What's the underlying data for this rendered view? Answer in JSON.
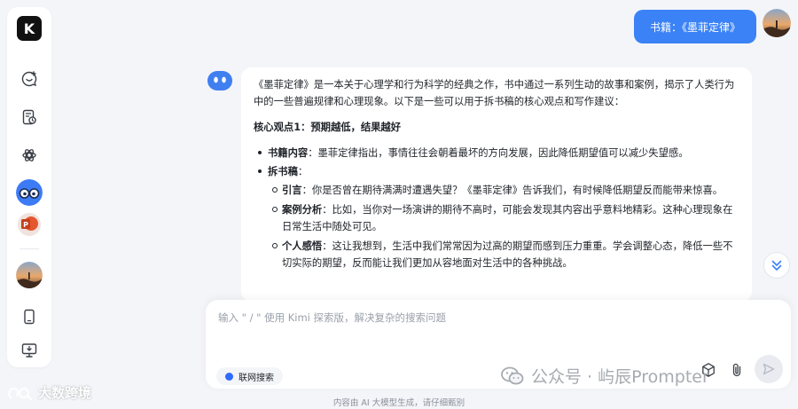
{
  "sidebar": {
    "logo_label": "K",
    "items": [
      {
        "name": "new-chat",
        "icon": "new-chat-icon"
      },
      {
        "name": "history",
        "icon": "history-icon"
      },
      {
        "name": "kimi-plus",
        "icon": "apps-icon"
      },
      {
        "name": "agent-glasses",
        "icon": "glasses-avatar"
      },
      {
        "name": "ppt-agent",
        "icon": "ppt-icon"
      },
      {
        "name": "user-profile",
        "icon": "avatar"
      },
      {
        "name": "mobile-app",
        "icon": "phone-icon"
      },
      {
        "name": "desktop-app",
        "icon": "desktop-icon"
      }
    ]
  },
  "chat": {
    "user_message": "书籍：《墨菲定律》",
    "answer": {
      "intro": "《墨菲定律》是一本关于心理学和行为科学的经典之作，书中通过一系列生动的故事和案例，揭示了人类行为中的一些普遍规律和心理现象。以下是一些可以用于拆书稿的核心观点和写作建议：",
      "heading": "核心观点1：预期越低，结果越好",
      "book_content_label": "书籍内容",
      "book_content_text": "：墨菲定律指出，事情往往会朝着最坏的方向发展，因此降低期望值可以减少失望感。",
      "breakdown_label": "拆书稿",
      "breakdown_colon": "：",
      "sub_items": [
        {
          "label": "引言",
          "text": "：你是否曾在期待满满时遭遇失望？《墨菲定律》告诉我们，有时候降低期望反而能带来惊喜。"
        },
        {
          "label": "案例分析",
          "text": "：比如，当你对一场演讲的期待不高时，可能会发现其内容出乎意料地精彩。这种心理现象在日常生活中随处可见。"
        },
        {
          "label": "个人感悟",
          "text": "：这让我想到，生活中我们常常因为过高的期望而感到压力重重。学会调整心态，降低一些不切实际的期望，反而能让我们更加从容地面对生活中的各种挑战。"
        }
      ]
    }
  },
  "input": {
    "placeholder": "输入 \" / \" 使用 Kimi 探索版，解决复杂的搜索问题",
    "web_search_label": "联网搜索"
  },
  "footer_note": "内容由 AI 大模型生成，请仔细甄别",
  "watermarks": {
    "left": "大数跨境",
    "right": "公众号 · 屿辰Prompter"
  },
  "colors": {
    "accent": "#3b82f6",
    "background": "#f4f5f9",
    "web_search_dot": "#2f6bff"
  }
}
